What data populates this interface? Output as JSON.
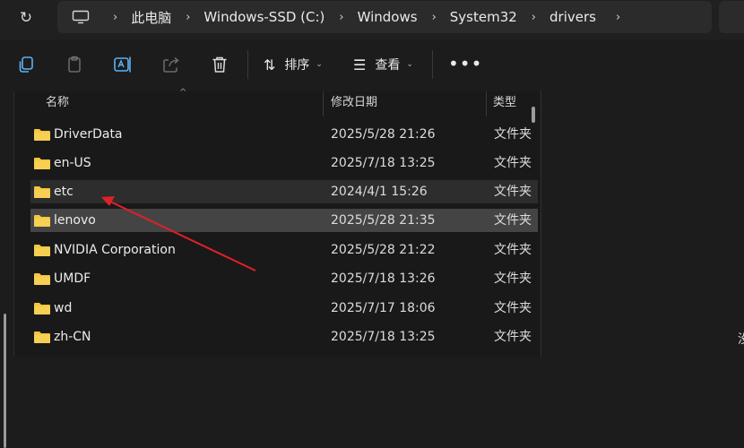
{
  "address": {
    "crumbs": [
      "此电脑",
      "Windows-SSD (C:)",
      "Windows",
      "System32",
      "drivers"
    ],
    "separator": "›"
  },
  "toolbar": {
    "sort_label": "排序",
    "view_label": "查看",
    "more_label": "•••",
    "caret": "⌄"
  },
  "columns": {
    "name": "名称",
    "date": "修改日期",
    "type": "类型",
    "sort_indicator": "^"
  },
  "files": [
    {
      "name": "DriverData",
      "date": "2025/5/28 21:26",
      "type": "文件夹"
    },
    {
      "name": "en-US",
      "date": "2025/7/18 13:25",
      "type": "文件夹"
    },
    {
      "name": "etc",
      "date": "2024/4/1 15:26",
      "type": "文件夹"
    },
    {
      "name": "lenovo",
      "date": "2025/5/28 21:35",
      "type": "文件夹"
    },
    {
      "name": "NVIDIA Corporation",
      "date": "2025/5/28 21:22",
      "type": "文件夹"
    },
    {
      "name": "UMDF",
      "date": "2025/7/18 13:26",
      "type": "文件夹"
    },
    {
      "name": "wd",
      "date": "2025/7/17 18:06",
      "type": "文件夹"
    },
    {
      "name": "zh-CN",
      "date": "2025/7/18 13:25",
      "type": "文件夹"
    }
  ],
  "details": {
    "text": "没"
  },
  "colors": {
    "annotation_arrow": "#e0202a",
    "folder": "#f4c53d",
    "selected_row": "#444444",
    "hover_row": "#2d2d2d"
  }
}
